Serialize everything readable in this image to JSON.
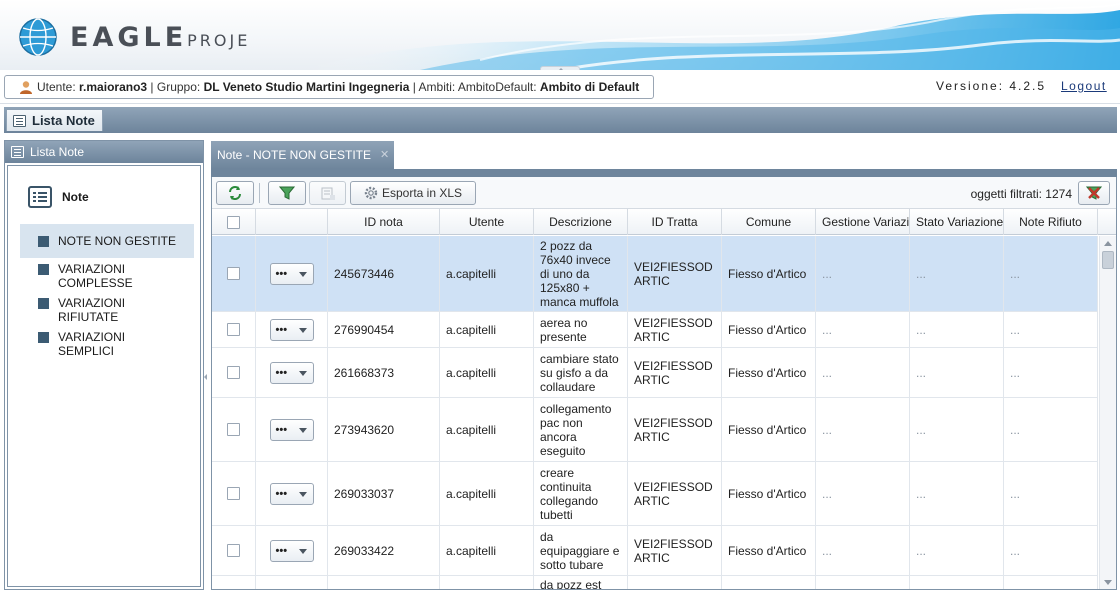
{
  "banner": {
    "logo_text": "EAGLE",
    "logo_text_small": "PROJE"
  },
  "user": {
    "label_user": "Utente:",
    "username": "r.maiorano3",
    "label_group": "| Gruppo:",
    "group": "DL Veneto Studio Martini Ingegneria",
    "label_scope": "| Ambiti: AmbitoDefault:",
    "scope": "Ambito di Default"
  },
  "version": "Versione: 4.2.5",
  "logout": "Logout",
  "section": {
    "title": "Lista Note"
  },
  "left": {
    "title": "Lista Note",
    "root": "Note",
    "items": [
      {
        "label": "NOTE NON GESTITE"
      },
      {
        "label": "VARIAZIONI COMPLESSE"
      },
      {
        "label": "VARIAZIONI RIFIUTATE"
      },
      {
        "label": "VARIAZIONI SEMPLICI"
      }
    ]
  },
  "main": {
    "tab_title": "Note - NOTE NON GESTITE",
    "export_label": "Esporta in XLS",
    "count_label": "oggetti filtrati: 1274",
    "columns": [
      "ID nota",
      "Utente",
      "Descrizione",
      "ID Tratta",
      "Comune",
      "Gestione Variazi",
      "Stato Variazione",
      "Note Rifiuto"
    ],
    "rows": [
      {
        "id": "245673446",
        "user": "a.capitelli",
        "desc": "2 pozz da 76x40 invece di uno da 125x80 + manca muffola",
        "tratta": "VEI2FIESSOD ARTIC",
        "comune": "Fiesso d'Artico",
        "g": "...",
        "s": "...",
        "n": "..."
      },
      {
        "id": "276990454",
        "user": "a.capitelli",
        "desc": "aerea no presente",
        "tratta": "VEI2FIESSOD ARTIC",
        "comune": "Fiesso d'Artico",
        "g": "...",
        "s": "...",
        "n": "..."
      },
      {
        "id": "261668373",
        "user": "a.capitelli",
        "desc": "cambiare stato su gisfo a da collaudare",
        "tratta": "VEI2FIESSOD ARTIC",
        "comune": "Fiesso d'Artico",
        "g": "...",
        "s": "...",
        "n": "..."
      },
      {
        "id": "273943620",
        "user": "a.capitelli",
        "desc": "collegamento pac non ancora eseguito",
        "tratta": "VEI2FIESSOD ARTIC",
        "comune": "Fiesso d'Artico",
        "g": "...",
        "s": "...",
        "n": "..."
      },
      {
        "id": "269033037",
        "user": "a.capitelli",
        "desc": "creare continuita collegando tubetti",
        "tratta": "VEI2FIESSOD ARTIC",
        "comune": "Fiesso d'Artico",
        "g": "...",
        "s": "...",
        "n": "..."
      },
      {
        "id": "269033422",
        "user": "a.capitelli",
        "desc": "da equipaggiare e sotto tubare",
        "tratta": "VEI2FIESSOD ARTIC",
        "comune": "Fiesso d'Artico",
        "g": "...",
        "s": "...",
        "n": "..."
      },
      {
        "id": "",
        "user": "",
        "desc": "da pozz est",
        "tratta": "",
        "comune": "",
        "g": "",
        "s": "",
        "n": ""
      }
    ],
    "row_menu_label": "•••"
  },
  "colors": {
    "header_blue": "#6e859c",
    "selected_row": "#cfe1f5",
    "accent_green": "#2a8a3a",
    "accent_red": "#c0392b"
  },
  "icons": [
    "user-icon",
    "list-icon",
    "refresh-icon",
    "filter-icon",
    "clear-filter-icon",
    "gear-icon",
    "remove-filter-icon"
  ]
}
